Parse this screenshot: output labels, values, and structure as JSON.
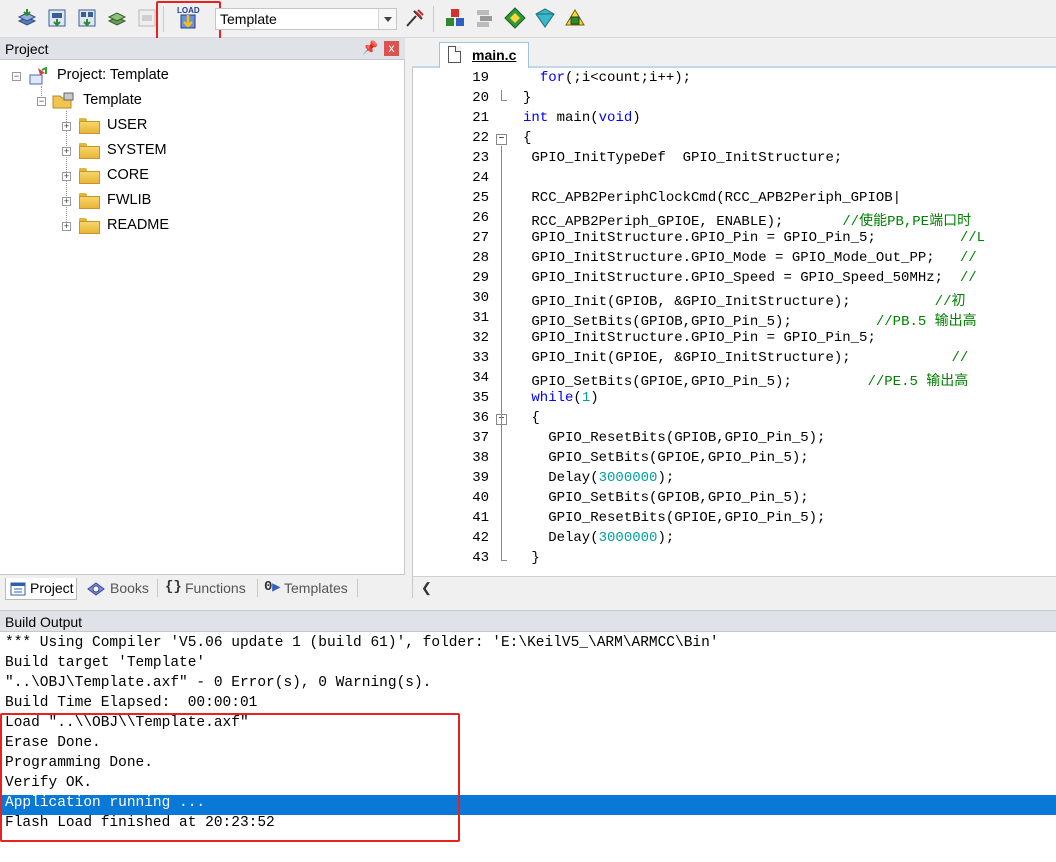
{
  "toolbar": {
    "load_label": "LOAD",
    "target": "Template"
  },
  "project": {
    "panel_title": "Project",
    "pin": "ᵖ",
    "close": "x",
    "root": "Project: Template",
    "target": "Template",
    "groups": [
      "USER",
      "SYSTEM",
      "CORE",
      "FWLIB",
      "README"
    ],
    "tabs": [
      "Project",
      "Books",
      "Functions",
      "Templates"
    ]
  },
  "editor": {
    "tab_label": "main.c",
    "lines": [
      {
        "n": "19",
        "fold": "",
        "text": "  for(;i<count;i++);"
      },
      {
        "n": "20",
        "fold": "end",
        "text": "}"
      },
      {
        "n": "21",
        "fold": "",
        "text": "int main(void)"
      },
      {
        "n": "22",
        "fold": "box",
        "text": "{"
      },
      {
        "n": "23",
        "fold": "",
        "text": " GPIO_InitTypeDef  GPIO_InitStructure;"
      },
      {
        "n": "24",
        "fold": "",
        "text": ""
      },
      {
        "n": "25",
        "fold": "",
        "text": " RCC_APB2PeriphClockCmd(RCC_APB2Periph_GPIOB|"
      },
      {
        "n": "26",
        "fold": "",
        "text": " RCC_APB2Periph_GPIOE, ENABLE);       //使能PB,PE端口时"
      },
      {
        "n": "27",
        "fold": "",
        "text": " GPIO_InitStructure.GPIO_Pin = GPIO_Pin_5;          //L"
      },
      {
        "n": "28",
        "fold": "",
        "text": " GPIO_InitStructure.GPIO_Mode = GPIO_Mode_Out_PP;   //"
      },
      {
        "n": "29",
        "fold": "",
        "text": " GPIO_InitStructure.GPIO_Speed = GPIO_Speed_50MHz;  //"
      },
      {
        "n": "30",
        "fold": "",
        "text": " GPIO_Init(GPIOB, &GPIO_InitStructure);          //初"
      },
      {
        "n": "31",
        "fold": "",
        "text": " GPIO_SetBits(GPIOB,GPIO_Pin_5);          //PB.5 输出高"
      },
      {
        "n": "32",
        "fold": "",
        "text": " GPIO_InitStructure.GPIO_Pin = GPIO_Pin_5;"
      },
      {
        "n": "33",
        "fold": "",
        "text": " GPIO_Init(GPIOE, &GPIO_InitStructure);            //"
      },
      {
        "n": "34",
        "fold": "",
        "text": " GPIO_SetBits(GPIOE,GPIO_Pin_5);         //PE.5 输出高"
      },
      {
        "n": "35",
        "fold": "",
        "text": " while(1)"
      },
      {
        "n": "36",
        "fold": "box",
        "text": " {"
      },
      {
        "n": "37",
        "fold": "",
        "text": "   GPIO_ResetBits(GPIOB,GPIO_Pin_5);"
      },
      {
        "n": "38",
        "fold": "",
        "text": "   GPIO_SetBits(GPIOE,GPIO_Pin_5);"
      },
      {
        "n": "39",
        "fold": "",
        "text": "   Delay(3000000);"
      },
      {
        "n": "40",
        "fold": "",
        "text": "   GPIO_SetBits(GPIOB,GPIO_Pin_5);"
      },
      {
        "n": "41",
        "fold": "",
        "text": "   GPIO_ResetBits(GPIOE,GPIO_Pin_5);"
      },
      {
        "n": "42",
        "fold": "",
        "text": "   Delay(3000000);"
      },
      {
        "n": "43",
        "fold": "end",
        "text": " }"
      }
    ]
  },
  "build": {
    "title": "Build Output",
    "lines": [
      "*** Using Compiler 'V5.06 update 1 (build 61)', folder: 'E:\\KeilV5_\\ARM\\ARMCC\\Bin'",
      "Build target 'Template'",
      "\"..\\OBJ\\Template.axf\" - 0 Error(s), 0 Warning(s).",
      "Build Time Elapsed:  00:00:01",
      "Load \"..\\\\OBJ\\\\Template.axf\"",
      "Erase Done.",
      "Programming Done.",
      "Verify OK.",
      "Application running ...",
      "Flash Load finished at 20:23:52"
    ],
    "selected_index": 8
  },
  "colors": {
    "highlight": "#e8231f",
    "selection": "#0a78d7",
    "keyword": "#0000ff",
    "number": "#00a0a0",
    "comment": "#008000"
  }
}
